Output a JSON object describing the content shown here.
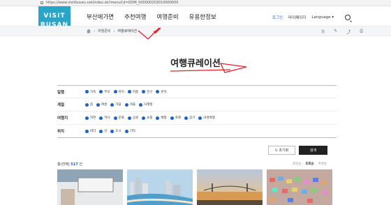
{
  "browser": {
    "url": "https://www.visitbusan.net/index.do?menuCd=DOM_000000203010000000"
  },
  "logo": {
    "line1": "VISIT",
    "line2": "BUSAN"
  },
  "gnb": [
    "부산에가면",
    "추천여행",
    "여행준비",
    "유용한정보"
  ],
  "util": {
    "login": "로그인",
    "mypage": "마이페이지",
    "language": "Language ▾"
  },
  "breadcrumb": {
    "items": [
      "여행준비",
      "여행큐레이션"
    ]
  },
  "page_title": "여행큐레이션",
  "filters": [
    {
      "label": "일행",
      "options": [
        "가족",
        "부모",
        "아이",
        "커플",
        "친구",
        "혼자"
      ]
    },
    {
      "label": "계절",
      "options": [
        "봄",
        "여름",
        "가을",
        "겨울",
        "사계절"
      ]
    },
    {
      "label": "여행지",
      "options": [
        "자연",
        "역사",
        "문화",
        "공원",
        "쇼핑",
        "체험",
        "축제",
        "걷기",
        "야경여행"
      ]
    },
    {
      "label": "위치",
      "options": [
        "바다",
        "산",
        "도시",
        "기타"
      ]
    }
  ],
  "buttons": {
    "reset": "↻ 초기화",
    "search": "검색"
  },
  "result": {
    "prefix": "총(전체)",
    "count": "517",
    "suffix": "건"
  },
  "sort": [
    "최신순",
    "조회순",
    "추천순"
  ],
  "colors": {
    "brand": "#2aa5c8",
    "accent": "#1d62c7",
    "annotation": "#e0202a"
  }
}
